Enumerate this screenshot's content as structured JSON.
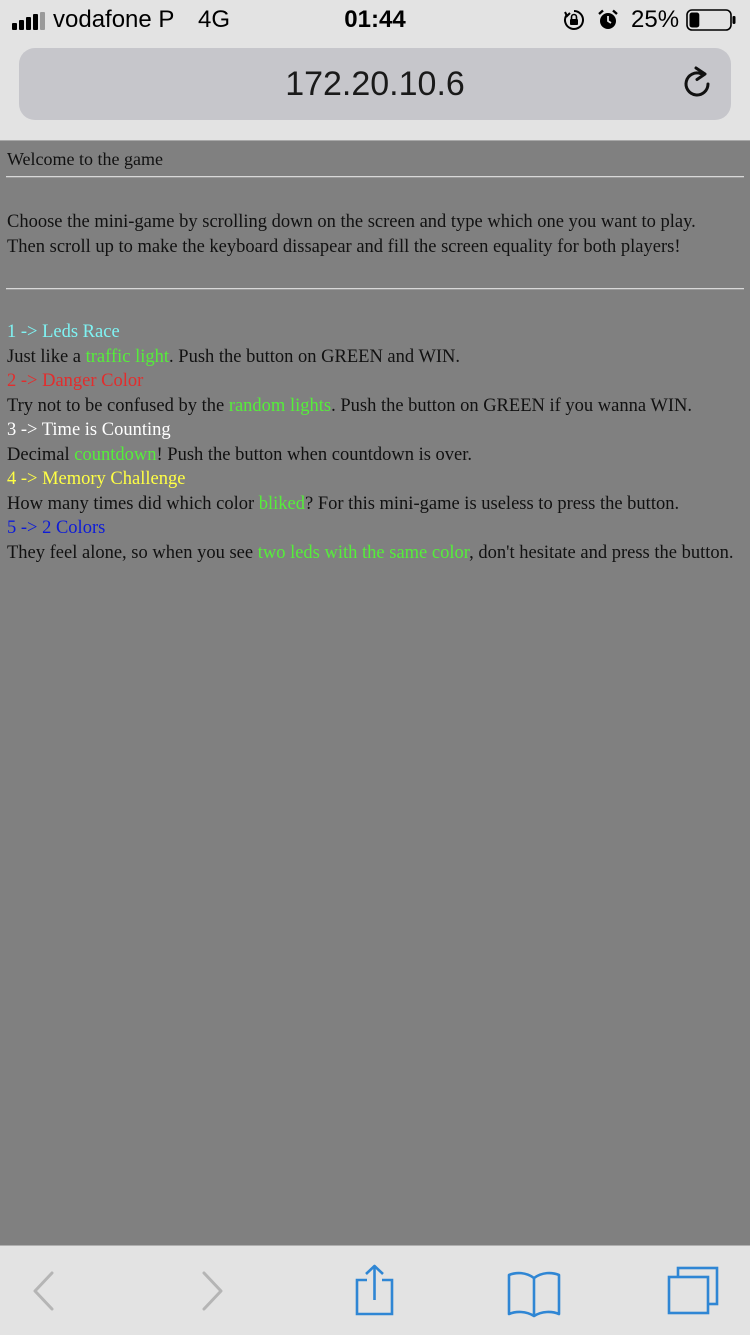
{
  "status_bar": {
    "carrier": "vodafone P",
    "network": "4G",
    "time": "01:44",
    "battery_percent": "25%",
    "battery_level": 0.25,
    "icons": [
      "signal-icon",
      "orientation-lock-icon",
      "alarm-icon",
      "battery-icon"
    ]
  },
  "browser": {
    "url": "172.20.10.6",
    "reload_icon": "reload-icon"
  },
  "page": {
    "welcome": "Welcome to the game",
    "intro": "Choose the mini-game by scrolling down on the screen and type which one you want to play. Then scroll up to make the keyboard dissapear and fill the screen equality for both players!",
    "games": [
      {
        "title": "1 -> Leds Race",
        "title_color": "#7ff3f3",
        "desc_pre": "Just like a ",
        "desc_highlight": "traffic light",
        "desc_post": ". Push the button on GREEN and WIN."
      },
      {
        "title": "2 -> Danger Color",
        "title_color": "#e22d2d",
        "desc_pre": "Try not to be confused by the ",
        "desc_highlight": "random lights",
        "desc_post": ". Push the button on GREEN if you wanna WIN."
      },
      {
        "title": "3 -> Time is Counting",
        "title_color": "#ffffff",
        "desc_pre": "Decimal ",
        "desc_highlight": "countdown",
        "desc_post": "! Push the button when countdown is over."
      },
      {
        "title": "4 -> Memory Challenge",
        "title_color": "#ffff44",
        "desc_pre": "How many times did which color ",
        "desc_highlight": "bliked",
        "desc_post": "? For this mini-game is useless to press the button."
      },
      {
        "title": "5 -> 2 Colors",
        "title_color": "#0d1bd8",
        "desc_pre": "They feel alone, so when you see ",
        "desc_highlight": "two leds with the same color",
        "desc_post": ", don't hesitate and press the button."
      }
    ],
    "highlight_color": "#55ee3a"
  },
  "toolbar": {
    "icons": [
      "back-icon",
      "forward-icon",
      "share-icon",
      "bookmarks-icon",
      "tabs-icon"
    ]
  }
}
